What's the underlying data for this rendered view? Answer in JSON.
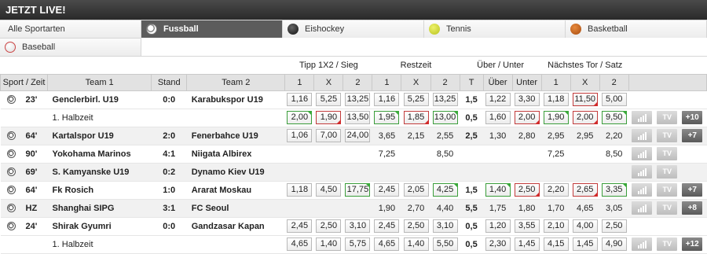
{
  "header": {
    "title": "JETZT LIVE!"
  },
  "sports": [
    {
      "label": "Alle Sportarten",
      "icon": "",
      "active": false
    },
    {
      "label": "Fussball",
      "icon": "soccer-ball-icon",
      "active": true
    },
    {
      "label": "Eishockey",
      "icon": "hockey-puck-icon",
      "active": false
    },
    {
      "label": "Tennis",
      "icon": "tennis-ball-icon",
      "active": false
    },
    {
      "label": "Basketball",
      "icon": "basketball-icon",
      "active": false
    },
    {
      "label": "Baseball",
      "icon": "baseball-icon",
      "active": false
    }
  ],
  "group_headers": {
    "tipp": "Tipp 1X2 / Sieg",
    "rest": "Restzeit",
    "ou": "Über / Unter",
    "next": "Nächstes Tor / Satz"
  },
  "columns": {
    "sport_zeit": "Sport / Zeit",
    "team1": "Team 1",
    "stand": "Stand",
    "team2": "Team 2",
    "c1": "1",
    "cx": "X",
    "c2": "2",
    "t": "T",
    "ueber": "Über",
    "unter": "Unter"
  },
  "matches": [
    {
      "time": "23'",
      "team1": "Genclerbirl. U19",
      "score": "0:0",
      "team2": "Karabukspor U19",
      "tipp": [
        {
          "v": "1,16",
          "s": ""
        },
        {
          "v": "5,25",
          "s": ""
        },
        {
          "v": "13,25",
          "s": ""
        }
      ],
      "rest": [
        {
          "v": "1,16",
          "s": ""
        },
        {
          "v": "5,25",
          "s": ""
        },
        {
          "v": "13,25",
          "s": ""
        }
      ],
      "t": "1,5",
      "ou": [
        {
          "v": "1,22",
          "s": ""
        },
        {
          "v": "3,30",
          "s": ""
        }
      ],
      "next": [
        {
          "v": "1,18",
          "s": ""
        },
        {
          "v": "11,50",
          "s": "down"
        },
        {
          "v": "5,00",
          "s": ""
        }
      ],
      "more": "",
      "has_actions": false
    },
    {
      "time": "",
      "team1": "1. Halbzeit",
      "score": "",
      "team2": "",
      "sub": true,
      "tipp": [
        {
          "v": "2,00",
          "s": "up"
        },
        {
          "v": "1,90",
          "s": "down"
        },
        {
          "v": "13,50",
          "s": ""
        }
      ],
      "rest": [
        {
          "v": "1,95",
          "s": "up"
        },
        {
          "v": "1,85",
          "s": "down"
        },
        {
          "v": "13,00",
          "s": "up"
        }
      ],
      "t": "0,5",
      "ou": [
        {
          "v": "1,60",
          "s": ""
        },
        {
          "v": "2,00",
          "s": "down"
        }
      ],
      "next": [
        {
          "v": "1,90",
          "s": "up"
        },
        {
          "v": "2,00",
          "s": "down"
        },
        {
          "v": "9,50",
          "s": "up"
        }
      ],
      "more": "+10",
      "has_actions": true
    },
    {
      "time": "64'",
      "team1": "Kartalspor U19",
      "score": "2:0",
      "team2": "Fenerbahce U19",
      "tipp": [
        {
          "v": "1,06",
          "s": ""
        },
        {
          "v": "7,00",
          "s": ""
        },
        {
          "v": "24,00",
          "s": ""
        }
      ],
      "rest": [
        {
          "v": "3,65",
          "s": "plain"
        },
        {
          "v": "2,15",
          "s": "plain"
        },
        {
          "v": "2,55",
          "s": "plain"
        }
      ],
      "t": "2,5",
      "ou": [
        {
          "v": "1,30",
          "s": "plain"
        },
        {
          "v": "2,80",
          "s": "plain"
        }
      ],
      "next": [
        {
          "v": "2,95",
          "s": "plain"
        },
        {
          "v": "2,95",
          "s": "plain"
        },
        {
          "v": "2,20",
          "s": "plain"
        }
      ],
      "more": "+7",
      "has_actions": true
    },
    {
      "time": "90'",
      "team1": "Yokohama Marinos",
      "score": "4:1",
      "team2": "Niigata Albirex",
      "tipp": [
        {
          "v": "",
          "s": ""
        },
        {
          "v": "",
          "s": ""
        },
        {
          "v": "",
          "s": ""
        }
      ],
      "rest": [
        {
          "v": "7,25",
          "s": "plain"
        },
        {
          "v": "",
          "s": ""
        },
        {
          "v": "8,50",
          "s": "plain"
        }
      ],
      "t": "",
      "ou": [
        {
          "v": "",
          "s": ""
        },
        {
          "v": "",
          "s": ""
        }
      ],
      "next": [
        {
          "v": "7,25",
          "s": "plain"
        },
        {
          "v": "",
          "s": ""
        },
        {
          "v": "8,50",
          "s": "plain"
        }
      ],
      "more": "",
      "has_actions": true
    },
    {
      "time": "69'",
      "team1": "S. Kamyanske U19",
      "score": "0:2",
      "team2": "Dynamo Kiev U19",
      "tipp": [
        {
          "v": "",
          "s": ""
        },
        {
          "v": "",
          "s": ""
        },
        {
          "v": "",
          "s": ""
        }
      ],
      "rest": [
        {
          "v": "",
          "s": ""
        },
        {
          "v": "",
          "s": ""
        },
        {
          "v": "",
          "s": ""
        }
      ],
      "t": "",
      "ou": [
        {
          "v": "",
          "s": ""
        },
        {
          "v": "",
          "s": ""
        }
      ],
      "next": [
        {
          "v": "",
          "s": ""
        },
        {
          "v": "",
          "s": ""
        },
        {
          "v": "",
          "s": ""
        }
      ],
      "more": "",
      "has_actions": true
    },
    {
      "time": "64'",
      "team1": "Fk Rosich",
      "score": "1:0",
      "team2": "Ararat Moskau",
      "tipp": [
        {
          "v": "1,18",
          "s": ""
        },
        {
          "v": "4,50",
          "s": ""
        },
        {
          "v": "17,75",
          "s": "up"
        }
      ],
      "rest": [
        {
          "v": "2,45",
          "s": ""
        },
        {
          "v": "2,05",
          "s": ""
        },
        {
          "v": "4,25",
          "s": "up"
        }
      ],
      "t": "1,5",
      "ou": [
        {
          "v": "1,40",
          "s": "up"
        },
        {
          "v": "2,50",
          "s": "down"
        }
      ],
      "next": [
        {
          "v": "2,20",
          "s": ""
        },
        {
          "v": "2,65",
          "s": "down"
        },
        {
          "v": "3,35",
          "s": "up"
        }
      ],
      "more": "+7",
      "has_actions": true
    },
    {
      "time": "HZ",
      "team1": "Shanghai SIPG",
      "score": "3:1",
      "team2": "FC Seoul",
      "tipp": [
        {
          "v": "",
          "s": ""
        },
        {
          "v": "",
          "s": ""
        },
        {
          "v": "",
          "s": ""
        }
      ],
      "rest": [
        {
          "v": "1,90",
          "s": "plain"
        },
        {
          "v": "2,70",
          "s": "plain"
        },
        {
          "v": "4,40",
          "s": "plain"
        }
      ],
      "t": "5,5",
      "ou": [
        {
          "v": "1,75",
          "s": "plain"
        },
        {
          "v": "1,80",
          "s": "plain"
        }
      ],
      "next": [
        {
          "v": "1,70",
          "s": "plain"
        },
        {
          "v": "4,65",
          "s": "plain"
        },
        {
          "v": "3,05",
          "s": "plain"
        }
      ],
      "more": "+8",
      "has_actions": true
    },
    {
      "time": "24'",
      "team1": "Shirak Gyumri",
      "score": "0:0",
      "team2": "Gandzasar Kapan",
      "tipp": [
        {
          "v": "2,45",
          "s": ""
        },
        {
          "v": "2,50",
          "s": ""
        },
        {
          "v": "3,10",
          "s": ""
        }
      ],
      "rest": [
        {
          "v": "2,45",
          "s": ""
        },
        {
          "v": "2,50",
          "s": ""
        },
        {
          "v": "3,10",
          "s": ""
        }
      ],
      "t": "0,5",
      "ou": [
        {
          "v": "1,20",
          "s": ""
        },
        {
          "v": "3,55",
          "s": ""
        }
      ],
      "next": [
        {
          "v": "2,10",
          "s": ""
        },
        {
          "v": "4,00",
          "s": ""
        },
        {
          "v": "2,50",
          "s": ""
        }
      ],
      "more": "",
      "has_actions": false
    },
    {
      "time": "",
      "team1": "1. Halbzeit",
      "score": "",
      "team2": "",
      "sub": true,
      "tipp": [
        {
          "v": "4,65",
          "s": ""
        },
        {
          "v": "1,40",
          "s": ""
        },
        {
          "v": "5,75",
          "s": ""
        }
      ],
      "rest": [
        {
          "v": "4,65",
          "s": ""
        },
        {
          "v": "1,40",
          "s": ""
        },
        {
          "v": "5,50",
          "s": ""
        }
      ],
      "t": "0,5",
      "ou": [
        {
          "v": "2,30",
          "s": ""
        },
        {
          "v": "1,45",
          "s": ""
        }
      ],
      "next": [
        {
          "v": "4,15",
          "s": ""
        },
        {
          "v": "1,45",
          "s": ""
        },
        {
          "v": "4,90",
          "s": ""
        }
      ],
      "more": "+12",
      "has_actions": true
    }
  ],
  "icons": {
    "ball": "soccer-ball-icon",
    "stats": "stats-bars-icon",
    "tv": "tv-icon"
  },
  "tv_label": "TV"
}
